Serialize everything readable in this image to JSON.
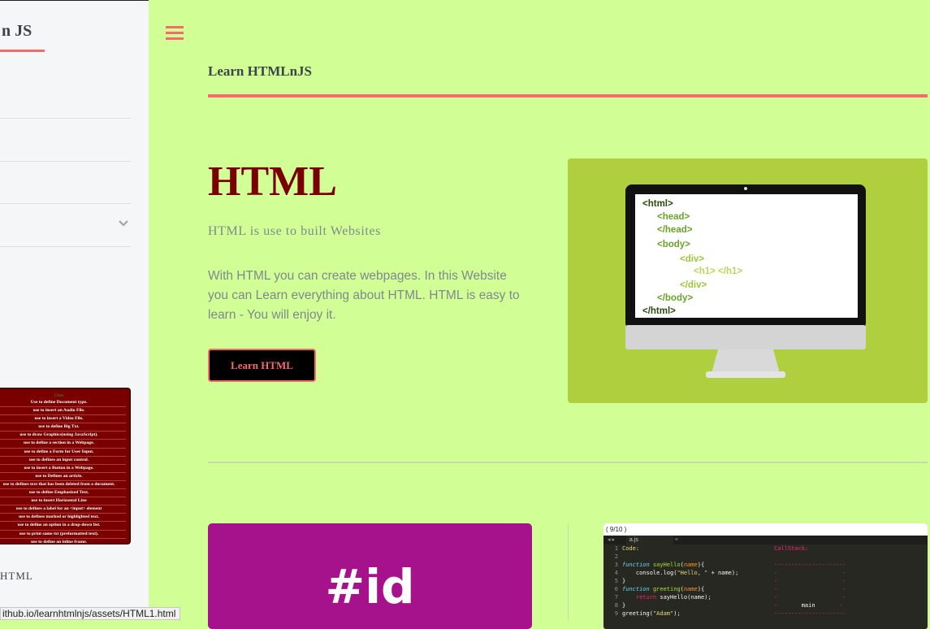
{
  "sidebar": {
    "title": "n JS",
    "table_header": "Uses",
    "table_rows": [
      "Use to define Document type.",
      "use to insert an Audio File.",
      "use to insert a Video File.",
      "use to define Big Txt.",
      "use to draw Graphics(using JavaScript).",
      "use to define a section in a Webpage.",
      "use to define a Form for User Input.",
      "use to defines an input control.",
      "use to insert a Button in a Webpage.",
      "use to Defines an article.",
      "use to defines text that has been deleted from a document.",
      "use to define Emphasized Text.",
      "use to insert Horizontal Line",
      "use to defines a label for an <input> element",
      "use to defines marked or highlighted text.",
      "use to define an option in a drop-down list.",
      "use to print same txt (preformatted text).",
      "use to define an inline frame."
    ],
    "bottom_label": "HTML",
    "chevron_icon": "chevron-down-icon"
  },
  "status_url": "ithub.io/learnhtmlnjs/assets/HTML1.html",
  "header": {
    "logo": "Learn HTMLnJS",
    "menu_icon": "hamburger-menu-icon"
  },
  "banner": {
    "title": "HTML",
    "subtitle": "HTML is use to built Websites",
    "text": "With HTML you can create webpages. In this Website you can Learn everything about HTML. HTML is easy to learn - You will enjoy it.",
    "button": "Learn HTML",
    "image_code": [
      "<html>",
      "<head>",
      "</head>",
      "<body>",
      "<div>",
      "<h1> </h1>",
      "</div>",
      "</body>",
      "</html>"
    ]
  },
  "cards": {
    "id_text": "#id",
    "code": {
      "counter": "( 9/10 )",
      "tab": "a.js",
      "code_label": "Code:",
      "callstack_label": "CallStack:",
      "callstack_main": "main"
    }
  },
  "colors": {
    "accent": "#f56a6a",
    "background": "#d1ff95",
    "title": "#7a0000",
    "id_card": "#a6128c",
    "image_bg": "#b0cf3f"
  }
}
